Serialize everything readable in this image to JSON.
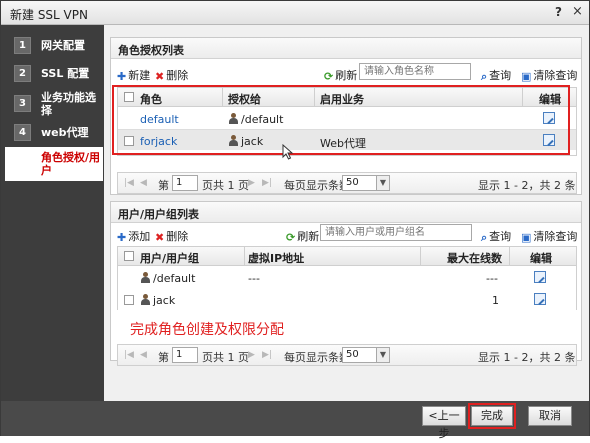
{
  "window": {
    "title": "新建 SSL VPN",
    "help": "?",
    "close": "×"
  },
  "steps": [
    {
      "num": "1",
      "label": "网关配置"
    },
    {
      "num": "2",
      "label": "SSL 配置"
    },
    {
      "num": "3",
      "label": "业务功能选择"
    },
    {
      "num": "4",
      "label": "web代理"
    },
    {
      "num": "5",
      "label": "角色授权/用户"
    }
  ],
  "roles": {
    "title": "角色授权列表",
    "add": "新建",
    "delete": "删除",
    "refresh": "刷新",
    "search_placeholder": "请输入角色名称",
    "query": "查询",
    "clear_query": "清除查询",
    "headers": {
      "role": "角色",
      "granted_to": "授权给",
      "enabled_service": "启用业务",
      "edit": "编辑"
    },
    "rows": [
      {
        "role": "default",
        "granted_to": "/default",
        "service": ""
      },
      {
        "role": "forjack",
        "granted_to": "jack",
        "service": "Web代理"
      }
    ],
    "pager": {
      "page_prefix": "第",
      "page": "1",
      "page_suffix": "页共 1 页",
      "per_page_label": "每页显示条数",
      "per_page": "50",
      "summary": "显示 1 - 2，共 2 条"
    }
  },
  "users": {
    "title": "用户/用户组列表",
    "add": "添加",
    "delete": "删除",
    "refresh": "刷新",
    "search_placeholder": "请输入用户或用户组名",
    "query": "查询",
    "clear_query": "清除查询",
    "headers": {
      "user": "用户/用户组",
      "virtual_ip": "虚拟IP地址",
      "max_online": "最大在线数",
      "edit": "编辑"
    },
    "rows": [
      {
        "user": "/default",
        "virtual_ip": "---",
        "max_online": "---"
      },
      {
        "user": "jack",
        "virtual_ip": "",
        "max_online": "1"
      }
    ],
    "pager": {
      "page_prefix": "第",
      "page": "1",
      "page_suffix": "页共 1 页",
      "per_page_label": "每页显示条数",
      "per_page": "50",
      "summary": "显示 1 - 2，共 2 条"
    }
  },
  "annotation": "完成角色创建及权限分配",
  "footer": {
    "prev": "<上一步",
    "finish": "完成",
    "cancel": "取消"
  },
  "colors": {
    "highlight": "#e02020",
    "sidebar": "#3d3d3d",
    "active_step_text": "#cc0000"
  }
}
